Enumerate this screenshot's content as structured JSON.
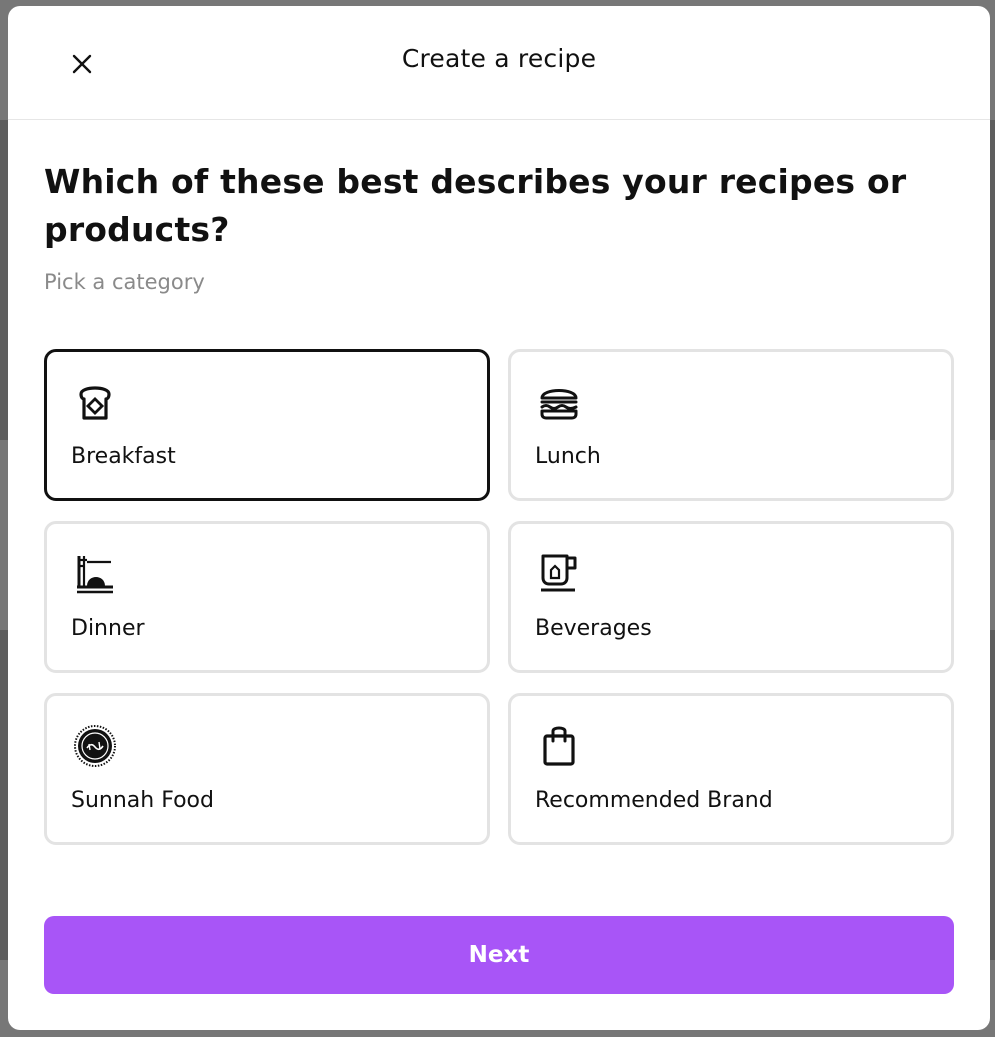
{
  "modal": {
    "title": "Create a recipe",
    "question": "Which of these best describes your recipes or products?",
    "subtitle": "Pick a category",
    "next_label": "Next"
  },
  "categories": [
    {
      "label": "Breakfast",
      "icon": "toast-icon",
      "selected": true
    },
    {
      "label": "Lunch",
      "icon": "burger-icon",
      "selected": false
    },
    {
      "label": "Dinner",
      "icon": "dinner-plate-icon",
      "selected": false
    },
    {
      "label": "Beverages",
      "icon": "mug-icon",
      "selected": false
    },
    {
      "label": "Sunnah Food",
      "icon": "sunnah-seal-icon",
      "selected": false
    },
    {
      "label": "Recommended Brand",
      "icon": "shopping-bag-icon",
      "selected": false
    }
  ],
  "colors": {
    "accent": "#a855f7",
    "selected_border": "#111111",
    "card_border": "#e3e3e3",
    "subtitle": "#8a8a8a"
  }
}
